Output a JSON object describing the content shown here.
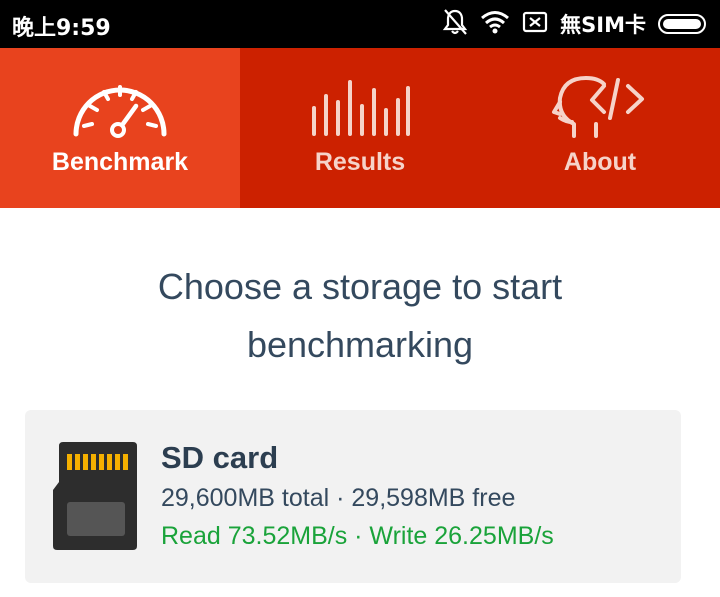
{
  "status_bar": {
    "time": "晚上9:59",
    "sim": "無SIM卡",
    "icons": [
      "bell-off-icon",
      "wifi-icon",
      "close-box-icon",
      "battery-icon"
    ]
  },
  "tabs": [
    {
      "label": "Benchmark",
      "icon": "speedometer-icon",
      "active": true
    },
    {
      "label": "Results",
      "icon": "bars-icon",
      "active": false
    },
    {
      "label": "About",
      "icon": "head-code-icon",
      "active": false
    }
  ],
  "main": {
    "heading_line1": "Choose a storage to start",
    "heading_line2": "benchmarking"
  },
  "storage": {
    "name": "SD card",
    "capacity": "29,600MB total · 29,598MB free",
    "speed": "Read 73.52MB/s · Write 26.25MB/s",
    "icon": "sd-card-icon"
  },
  "colors": {
    "tab_active": "#e8431e",
    "tab_inactive": "#cc2100",
    "heading": "#34495e",
    "speed": "#1aa33a",
    "card_bg": "#f2f2f2"
  }
}
